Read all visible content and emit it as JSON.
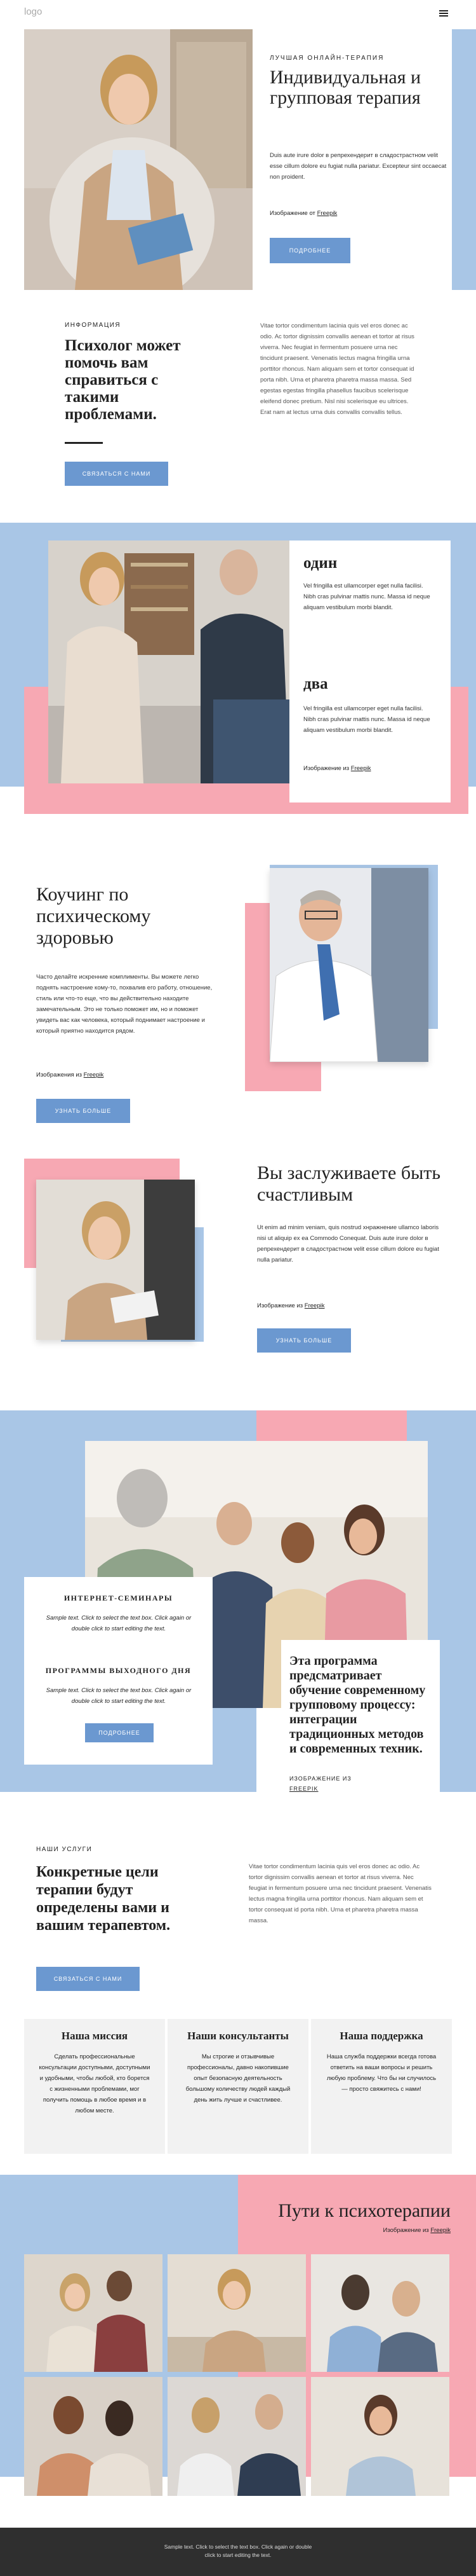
{
  "header": {
    "logo": "logo"
  },
  "hero": {
    "eyebrow": "ЛУЧШАЯ ОНЛАЙН-ТЕРАПИЯ",
    "title": "Индивидуальная и групповая терапия",
    "text": "Duis aute irure dolor в репрехендерит в сладострастном velit esse cillum dolore eu fugiat nulla pariatur. Excepteur sint occaecat non proident.",
    "credit_prefix": "Изображение от ",
    "credit_link": "Freepik",
    "button": "ПОДРОБНЕЕ"
  },
  "info": {
    "eyebrow": "ИНФОРМАЦИЯ",
    "title": "Психолог может помочь вам справиться с такими проблемами.",
    "button": "СВЯЗАТЬСЯ С НАМИ",
    "text": "Vitae tortor condimentum lacinia quis vel eros donec ac odio. Ac tortor dignissim convallis aenean et tortor at risus viverra. Nec feugiat in fermentum posuere urna nec tincidunt praesent. Venenatis lectus magna fringilla urna porttitor rhoncus. Nam aliquam sem et tortor consequat id porta nibh. Urna et pharetra pharetra massa massa. Sed egestas egestas fringilla phasellus faucibus scelerisque eleifend donec pretium. Nisl nisi scelerisque eu ultrices. Erat nam at lectus urna duis convallis convallis tellus."
  },
  "steps": {
    "one_title": "один",
    "one_text": "Vel fringilla est ullamcorper eget nulla facilisi. Nibh cras pulvinar mattis nunc. Massa id neque aliquam vestibulum morbi blandit.",
    "two_title": "два",
    "two_text": "Vel fringilla est ullamcorper eget nulla facilisi. Nibh cras pulvinar mattis nunc. Massa id neque aliquam vestibulum morbi blandit.",
    "credit_prefix": "Изображение из ",
    "credit_link": "Freepik"
  },
  "coaching": {
    "title": "Коучинг по психическому здоровью",
    "text": "Часто делайте искренние комплименты. Вы можете легко поднять настроение кому-то, похвалив его работу, отношение, стиль или что-то еще, что вы действительно находите замечательным. Это не только поможет им, но и поможет увидеть вас как человека, который поднимает настроение и который приятно находится рядом.",
    "credit_prefix": "Изображения из ",
    "credit_link": "Freepik",
    "button": "УЗНАТЬ БОЛЬШЕ"
  },
  "deserve": {
    "title": "Вы заслуживаете быть счастливым",
    "text": "Ut enim ad minim veniam, quis nostrud xнражнение ullamco laboris nisi ut aliquip ex ea Commodo Conequat. Duis aute irure dolor в репрехендерит в сладострастном velit esse cillum dolore eu fugiat nulla pariatur.",
    "credit_prefix": "Изображение из ",
    "credit_link": "Freepik",
    "button": "УЗНАТЬ БОЛЬШЕ"
  },
  "group": {
    "webinars_title": "ИНТЕРНЕТ-СЕМИНАРЫ",
    "webinars_text": "Sample text. Click to select the text box. Click again or double click to start editing the text.",
    "weekend_title": "ПРОГРАММЫ ВЫХОДНОГО ДНЯ",
    "weekend_text": "Sample text. Click to select the text box. Click again or double click to start editing the text.",
    "button": "ПОДРОБНЕЕ",
    "program_text": "Эта программа предсматривает обучение современному групповому процессу: интеграции традиционных методов и современных техник.",
    "credit_prefix": "ИЗОБРАЖЕНИЕ ИЗ ",
    "credit_link": "FREEPIK"
  },
  "services": {
    "eyebrow": "НАШИ УСЛУГИ",
    "title": "Конкретные цели терапии будут определены вами и вашим терапевтом.",
    "button": "СВЯЗАТЬСЯ С НАМИ",
    "text": "Vitae tortor condimentum lacinia quis vel eros donec ac odio. Ac tortor dignissim convallis aenean et tortor at risus viverra. Nec feugiat in fermentum posuere urna nec tincidunt praesent. Venenatis lectus magna fringilla urna porttitor rhoncus. Nam aliquam sem et tortor consequat id porta nibh. Urna et pharetra pharetra massa massa."
  },
  "cards": [
    {
      "title": "Наша миссия",
      "text": "Сделать профессиональные консультации доступными, доступными и удобными, чтобы любой, кто борется с жизненными проблемами, мог получить помощь в любое время и в любом месте."
    },
    {
      "title": "Наши консультанты",
      "text": "Мы строгие и отзывчивые профессионалы, давно накопившие опыт безопасную деятельность большому количеству людей каждый день жить лучше и счастливее."
    },
    {
      "title": "Наша поддержка",
      "text": "Наша служба поддержки всегда готова ответить на ваши вопросы и решить любую проблему. Что бы ни случилось — просто свяжитесь с нами!"
    }
  ],
  "gallery": {
    "title": "Пути к психотерапии",
    "credit_prefix": "Изображение из ",
    "credit_link": "Freepik"
  },
  "footer": {
    "line1": "Sample text. Click to select the text box. Click again or double",
    "line2": "click to start editing the text."
  },
  "colors": {
    "blue": "#a9c6e6",
    "pink": "#f7a8b3",
    "button": "#6b98d0",
    "footer": "#2f2f2f"
  }
}
